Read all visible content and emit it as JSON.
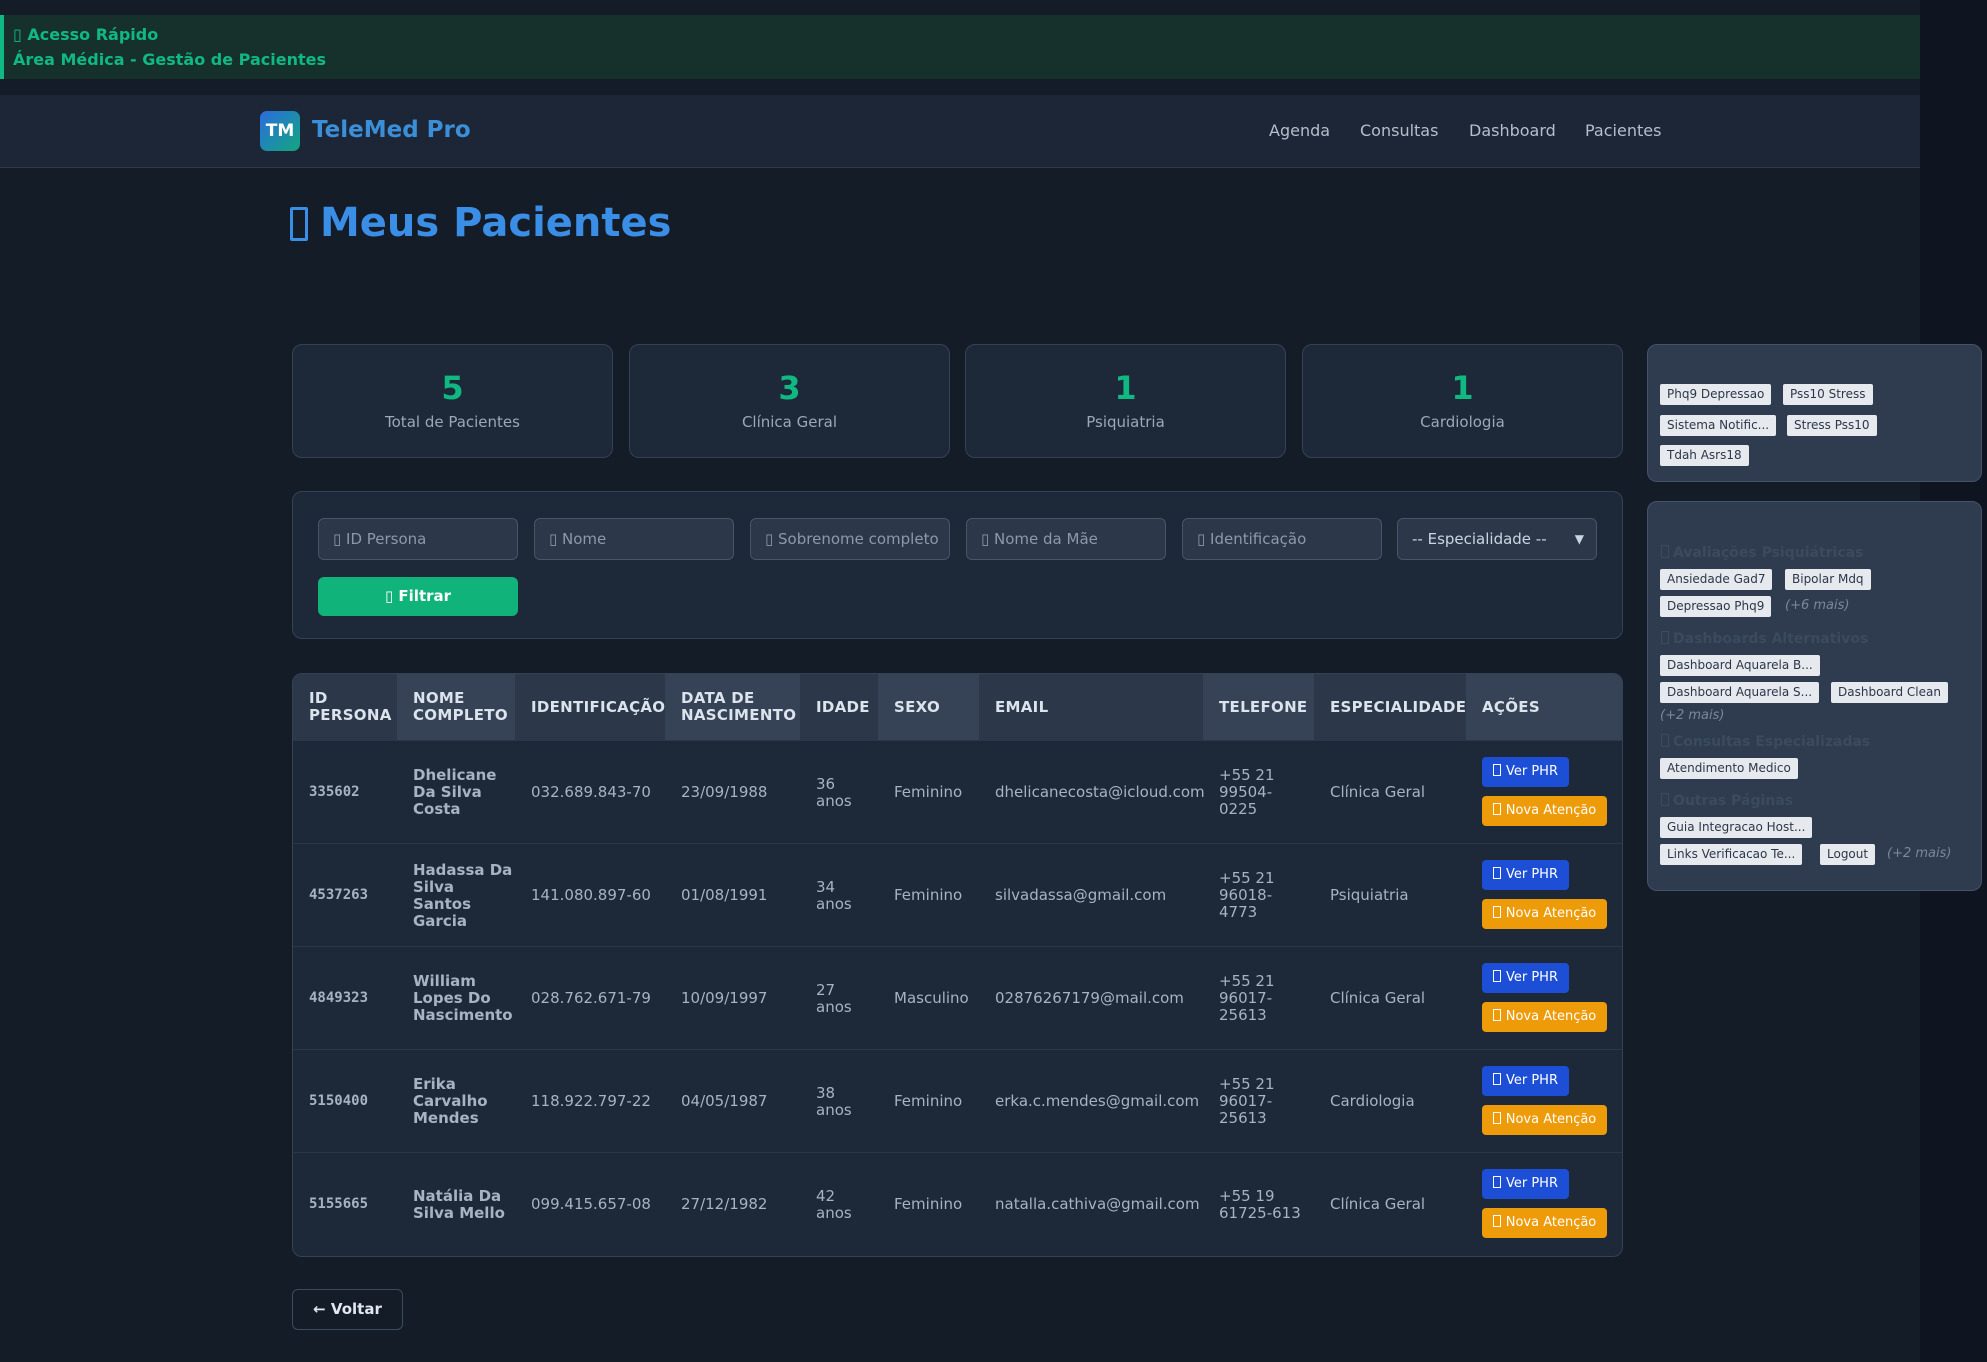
{
  "quick_access": {
    "title": "Acesso Rápido",
    "subtitle": "Área Médica - Gestão de Pacientes"
  },
  "navbar": {
    "logo": "TM",
    "brand": "TeleMed Pro",
    "links": [
      "Agenda",
      "Consultas",
      "Dashboard",
      "Pacientes"
    ]
  },
  "page": {
    "title": "Meus Pacientes"
  },
  "stats": [
    {
      "value": "5",
      "label": "Total de Pacientes"
    },
    {
      "value": "3",
      "label": "Clínica Geral"
    },
    {
      "value": "1",
      "label": "Psiquiatria"
    },
    {
      "value": "1",
      "label": "Cardiologia"
    }
  ],
  "filters": {
    "id_persona": "ID Persona",
    "nome": "Nome",
    "sobrenome": "Sobrenome completo",
    "nome_mae": "Nome da Mãe",
    "identificacao": "Identificação",
    "especialidade": "-- Especialidade --",
    "button": "Filtrar"
  },
  "table": {
    "headers": {
      "id1": "ID",
      "id2": "PERSONA",
      "nome1": "NOME",
      "nome2": "COMPLETO",
      "ident": "IDENTIFICAÇÃO",
      "nasc1": "DATA DE",
      "nasc2": "NASCIMENTO",
      "idade": "IDADE",
      "sexo": "SEXO",
      "email": "EMAIL",
      "telefone": "TELEFONE",
      "especialidade": "ESPECIALIDADE",
      "acoes": "AÇÕES"
    },
    "rows": [
      {
        "id": "335602",
        "name": [
          "Dhelicane",
          "Da Silva",
          "Costa"
        ],
        "ident": "032.689.843-70",
        "birth": "23/09/1988",
        "age": [
          "36",
          "anos"
        ],
        "sex": "Feminino",
        "email": "dhelicanecosta@icloud.com",
        "phone": [
          "+55 21",
          "99504-",
          "0225"
        ],
        "specialty": "Clínica Geral"
      },
      {
        "id": "4537263",
        "name": [
          "Hadassa Da",
          "Silva",
          "Santos",
          "Garcia"
        ],
        "ident": "141.080.897-60",
        "birth": "01/08/1991",
        "age": [
          "34",
          "anos"
        ],
        "sex": "Feminino",
        "email": "silvadassa@gmail.com",
        "phone": [
          "+55 21",
          "96018-",
          "4773"
        ],
        "specialty": "Psiquiatria"
      },
      {
        "id": "4849323",
        "name": [
          "William",
          "Lopes Do",
          "Nascimento"
        ],
        "ident": "028.762.671-79",
        "birth": "10/09/1997",
        "age": [
          "27",
          "anos"
        ],
        "sex": "Masculino",
        "email": "02876267179@mail.com",
        "phone": [
          "+55 21",
          "96017-",
          "25613"
        ],
        "specialty": "Clínica Geral"
      },
      {
        "id": "5150400",
        "name": [
          "Erika",
          "Carvalho",
          "Mendes"
        ],
        "ident": "118.922.797-22",
        "birth": "04/05/1987",
        "age": [
          "38",
          "anos"
        ],
        "sex": "Feminino",
        "email": "erka.c.mendes@gmail.com",
        "phone": [
          "+55 21",
          "96017-",
          "25613"
        ],
        "specialty": "Cardiologia"
      },
      {
        "id": "5155665",
        "name": [
          "Natália Da",
          "Silva Mello"
        ],
        "ident": "099.415.657-08",
        "birth": "27/12/1982",
        "age": [
          "42",
          "anos"
        ],
        "sex": "Feminino",
        "email": "natalla.cathiva@gmail.com",
        "phone": [
          "+55 19",
          "61725-613"
        ],
        "specialty": "Clínica Geral"
      }
    ],
    "action_phr": "Ver PHR",
    "action_nova": "Nova Atenção"
  },
  "back_button": "← Voltar",
  "side_panel_1": {
    "chips": [
      "Phq9 Depressao",
      "Pss10 Stress",
      "Sistema Notific...",
      "Stress Pss10",
      "Tdah Asrs18"
    ]
  },
  "side_panel_2": {
    "sections": [
      {
        "title": "Avaliações Psiquiátricas",
        "chips": [
          "Ansiedade Gad7",
          "Bipolar Mdq",
          "Depressao Phq9"
        ],
        "more": "(+6 mais)"
      },
      {
        "title": "Dashboards Alternativos",
        "chips": [
          "Dashboard Aquarela B...",
          "Dashboard Aquarela S...",
          "Dashboard Clean"
        ],
        "more": "(+2 mais)"
      },
      {
        "title": "Consultas Especializadas",
        "chips": [
          "Atendimento Medico"
        ]
      },
      {
        "title": "Outras Páginas",
        "chips": [
          "Guia Integracao Host...",
          "Links Verificacao Te...",
          "Logout"
        ],
        "more": "(+2 mais)"
      }
    ]
  },
  "colors": {
    "accent_green": "#10b981",
    "accent_blue": "#3b8ee6",
    "button_blue": "#1d4fd6",
    "button_orange": "#ee9b09"
  }
}
